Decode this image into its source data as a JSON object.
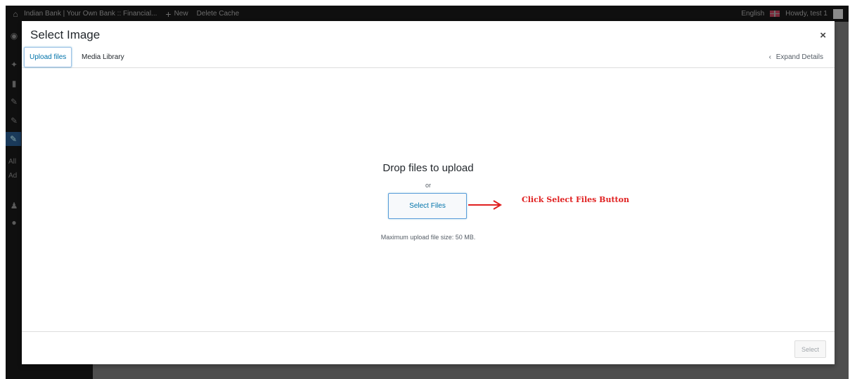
{
  "adminbar": {
    "site_name": "Indian Bank | Your Own Bank :: Financial...",
    "new_label": "New",
    "delete_cache": "Delete Cache",
    "language": "English",
    "howdy": "Howdy, test 1"
  },
  "sidemenu": {
    "all_label": "All",
    "add_label": "Ad"
  },
  "modal": {
    "title": "Select Image",
    "close": "×",
    "tabs": [
      {
        "label": "Upload files",
        "active": true
      },
      {
        "label": "Media Library",
        "active": false
      }
    ],
    "expand_details": "Expand Details",
    "expand_chevron": "‹"
  },
  "uploader": {
    "drop_title": "Drop files to upload",
    "or": "or",
    "select_files": "Select Files",
    "max_size": "Maximum upload file size: 50 MB."
  },
  "annotation": {
    "text": "Click Select Files Button",
    "color": "#e02020"
  },
  "toolbar": {
    "select_label": "Select"
  },
  "colors": {
    "accent": "#0073aa",
    "backdrop": "#4e4e4e",
    "adminbar": "#0f0f0f"
  }
}
